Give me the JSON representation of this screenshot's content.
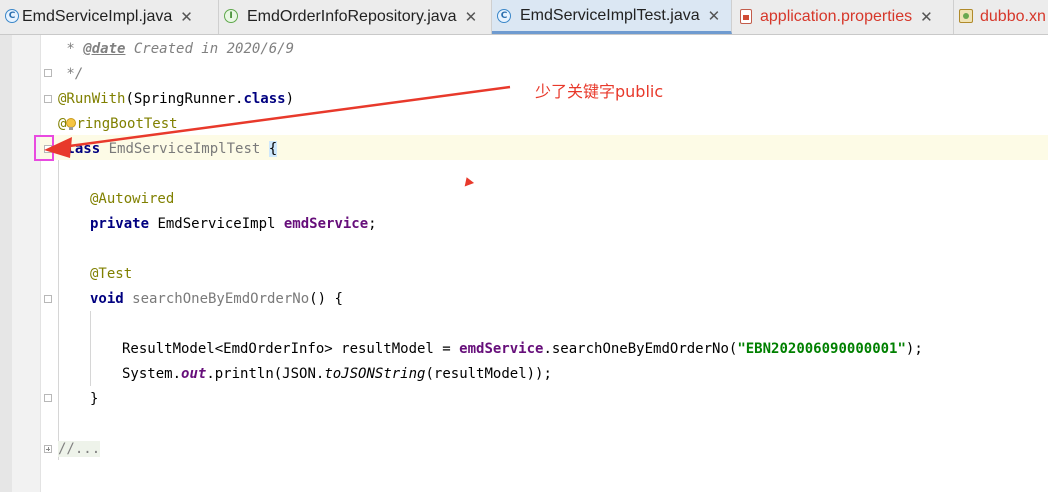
{
  "tabs": [
    {
      "label": "EmdServiceImpl.java",
      "icon": "class-icon",
      "close": "✕",
      "active": false,
      "error": false
    },
    {
      "label": "EmdOrderInfoRepository.java",
      "icon": "interface-icon",
      "close": "✕",
      "active": false,
      "error": false
    },
    {
      "label": "EmdServiceImplTest.java",
      "icon": "class-icon",
      "close": "✕",
      "active": true,
      "error": false
    },
    {
      "label": "application.properties",
      "icon": "properties-icon",
      "close": "✕",
      "active": false,
      "error": true
    },
    {
      "label": "dubbo.xn",
      "icon": "xml-icon",
      "close": "",
      "active": false,
      "error": true
    }
  ],
  "tab_icon_letters": {
    "class": "C",
    "interface": "I"
  },
  "code": {
    "line1": {
      "prefix": " * ",
      "tag": "@date",
      "text": " Created in 2020/6/9"
    },
    "line2": {
      "text": " */"
    },
    "line3": {
      "annotation": "@RunWith",
      "open": "(SpringRunner.",
      "kw": "class",
      "close": ")"
    },
    "line4": {
      "at": "@",
      "rest": "ringBootTest"
    },
    "line5": {
      "kw": "class",
      "space": " ",
      "name": "EmdServiceImplTest",
      "space2": " ",
      "brace": "{"
    },
    "line7": {
      "annotation": "@Autowired"
    },
    "line8": {
      "kw": "private",
      "type": " EmdServiceImpl ",
      "field": "emdService",
      "end": ";"
    },
    "line10": {
      "annotation": "@Test"
    },
    "line11": {
      "kw": "void",
      "method": " searchOneByEmdOrderNo",
      "rest": "() {"
    },
    "line13": {
      "pre": "ResultModel<EmdOrderInfo> resultModel = ",
      "field": "emdService",
      "call": ".searchOneByEmdOrderNo(",
      "str": "\"EBN202006090000001\"",
      "end": ");"
    },
    "line14": {
      "pre": "System.",
      "field": "out",
      "mid": ".println(JSON.",
      "static_call": "toJSONString",
      "end": "(resultModel));"
    },
    "line15": {
      "text": "}"
    },
    "line17": {
      "text": "//..."
    }
  },
  "annotation": {
    "label": "少了关键字public",
    "color": "#e8392b",
    "box_color": "#e84ae0"
  },
  "colors": {
    "keyword": "#000080",
    "annotation": "#808000",
    "comment": "#808080",
    "field": "#660e7a",
    "string": "#008000",
    "current_line": "#fdfbe6"
  }
}
